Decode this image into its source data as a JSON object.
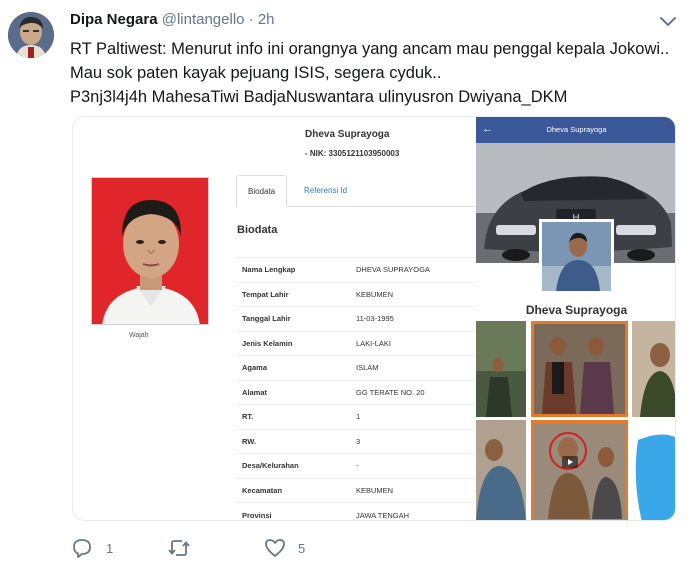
{
  "tweet": {
    "display_name": "Dipa Negara",
    "handle": "@lintangello",
    "separator": "·",
    "time": "2h",
    "lines": [
      "RT Paltiwest: Menurut info ini orangnya yang ancam mau penggal kepala Jokowi..",
      "Mau sok paten kayak pejuang ISIS, segera cyduk..",
      "P3nj3l4j4h MahesaTiwi   BadjaNuswantara ulinyusron Dwiyana_DKM"
    ]
  },
  "profile": {
    "name": "Dheva Suprayoga",
    "nik": "- NIK: 3305121103950003",
    "photo_caption": "Wajah",
    "tabs": [
      {
        "label": "Biodata"
      },
      {
        "label": "Referensi Id"
      }
    ],
    "section_title": "Biodata",
    "rows": [
      {
        "label": "Nama Lengkap",
        "value": "DHEVA SUPRAYOGA"
      },
      {
        "label": "Tempat Lahir",
        "value": "KEBUMEN"
      },
      {
        "label": "Tanggal Lahir",
        "value": "11-03-1995"
      },
      {
        "label": "Jenis Kelamin",
        "value": "LAKI-LAKI"
      },
      {
        "label": "Agama",
        "value": "ISLAM"
      },
      {
        "label": "Alamat",
        "value": "GG TERATE NO. 20"
      },
      {
        "label": "RT.",
        "value": "1"
      },
      {
        "label": "RW.",
        "value": "3"
      },
      {
        "label": "Desa/Kelurahan",
        "value": "-"
      },
      {
        "label": "Kecamatan",
        "value": "KEBUMEN"
      },
      {
        "label": "Provinsi",
        "value": "JAWA TENGAH"
      }
    ]
  },
  "facebook": {
    "back": "←",
    "title": "Dheva Suprayoga",
    "name": "Dheva Suprayoga",
    "bar_color": "#3b5998"
  },
  "actions": {
    "reply_count": "1",
    "retweet_count": "",
    "like_count": "5"
  },
  "colors": {
    "text": "#14171a",
    "secondary": "#657786",
    "photo_bg": "#e0262a",
    "link": "#2a7bb8"
  }
}
